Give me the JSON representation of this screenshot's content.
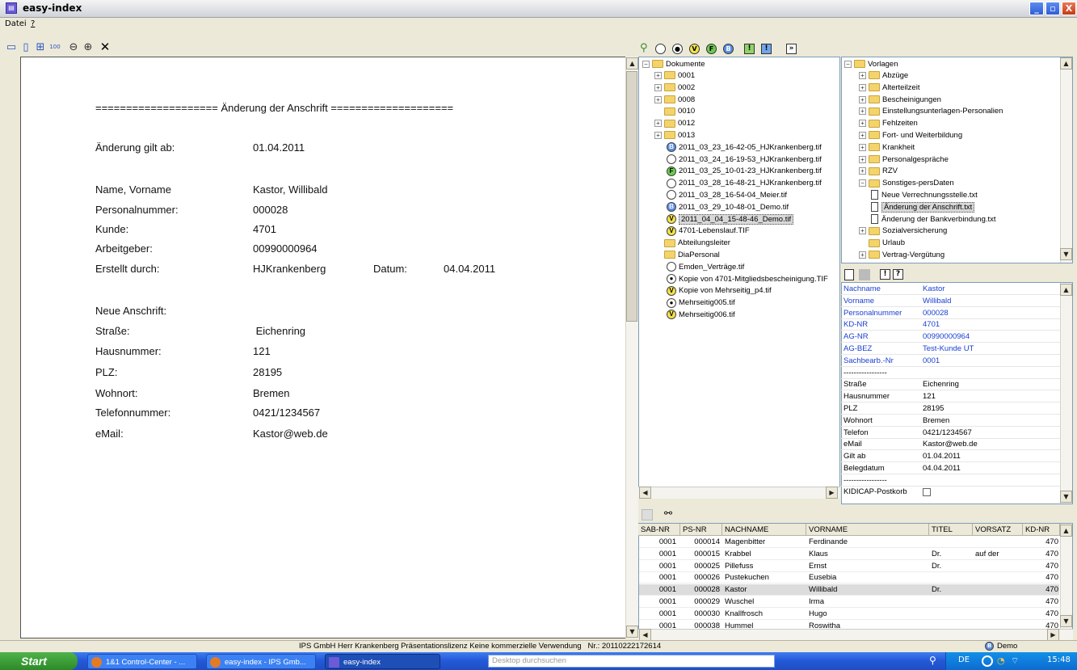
{
  "window": {
    "title": "easy-index",
    "min": "_",
    "max": "▫",
    "close": "X"
  },
  "menu": {
    "items": [
      "Datei",
      "?"
    ]
  },
  "toolbar_icons": [
    "rows-icon",
    "columns-icon",
    "grid-icon",
    "fit-icon",
    "zoom-out-icon",
    "zoom-in-icon",
    "close-icon"
  ],
  "document": {
    "heading": "==================== Änderung der Anschrift ====================",
    "change_label": "Änderung gilt ab:",
    "change_value": "01.04.2011",
    "rows": [
      {
        "label": "Name, Vorname",
        "value": "Kastor, Willibald"
      },
      {
        "label": "Personalnummer:",
        "value": "000028"
      },
      {
        "label": "Kunde:",
        "value": "4701"
      },
      {
        "label": "Arbeitgeber:",
        "value": "00990000964"
      },
      {
        "label": "Erstellt durch:",
        "value": "HJKrankenberg"
      }
    ],
    "datum_label": "Datum:",
    "datum_value": "04.04.2011",
    "new_address": "Neue Anschrift:",
    "addr": [
      {
        "label": "Straße:",
        "value": " Eichenring"
      },
      {
        "label": "Hausnummer:",
        "value": "121"
      },
      {
        "label": "PLZ:",
        "value": "28195"
      },
      {
        "label": "Wohnort:",
        "value": "Bremen"
      },
      {
        "label": "Telefonnummer:",
        "value": "0421/1234567"
      },
      {
        "label": "eMail:",
        "value": "Kastor@web.de"
      }
    ]
  },
  "filter_bar": {
    "marks": [
      "V",
      "F",
      "B"
    ],
    "warn": "!",
    "next": "»"
  },
  "tree_left": {
    "root": "Dokumente",
    "items": [
      {
        "type": "folder",
        "label": "0001",
        "exp": "+"
      },
      {
        "type": "folder",
        "label": "0002",
        "exp": "+"
      },
      {
        "type": "folder",
        "label": "0008",
        "exp": "+"
      },
      {
        "type": "folder",
        "label": "0010",
        "exp": ""
      },
      {
        "type": "folder",
        "label": "0012",
        "exp": "+"
      },
      {
        "type": "folder",
        "label": "0013",
        "exp": "+"
      },
      {
        "type": "file",
        "mark": "B",
        "label": "2011_03_23_16-42-05_HJKrankenberg.tif"
      },
      {
        "type": "file",
        "mark": "",
        "label": "2011_03_24_16-19-53_HJKrankenberg.tif"
      },
      {
        "type": "file",
        "mark": "F",
        "label": "2011_03_25_10-01-23_HJKrankenberg.tif"
      },
      {
        "type": "file",
        "mark": "",
        "label": "2011_03_28_16-48-21_HJKrankenberg.tif"
      },
      {
        "type": "file",
        "mark": "",
        "label": "2011_03_28_16-54-04_Meier.tif"
      },
      {
        "type": "file",
        "mark": "B",
        "label": "2011_03_29_10-48-01_Demo.tif"
      },
      {
        "type": "file",
        "mark": "V",
        "label": "2011_04_04_15-48-46_Demo.tif",
        "selected": true
      },
      {
        "type": "file",
        "mark": "V",
        "label": "4701-Lebenslauf.TIF"
      },
      {
        "type": "folder",
        "label": "Abteilungsleiter",
        "exp": ""
      },
      {
        "type": "folder",
        "label": "DiaPersonal",
        "exp": ""
      },
      {
        "type": "file",
        "mark": "",
        "label": "Emden_Verträge.tif"
      },
      {
        "type": "file",
        "mark": "dot",
        "label": "Kopie von 4701-Mitgliedsbescheinigung.TIF"
      },
      {
        "type": "file",
        "mark": "V",
        "label": "Kopie von Mehrseitig_p4.tif"
      },
      {
        "type": "file",
        "mark": "dot",
        "label": "Mehrseitig005.tif"
      },
      {
        "type": "file",
        "mark": "V",
        "label": "Mehrseitig006.tif"
      }
    ]
  },
  "tree_right": {
    "root": "Vorlagen",
    "items": [
      {
        "label": "Abzüge",
        "lvl": 1,
        "kind": "folder"
      },
      {
        "label": "Alterteilzeit",
        "lvl": 1,
        "kind": "folder"
      },
      {
        "label": "Bescheinigungen",
        "lvl": 1,
        "kind": "folder"
      },
      {
        "label": "Einstellungsunterlagen-Personalien",
        "lvl": 1,
        "kind": "folder"
      },
      {
        "label": "Fehlzeiten",
        "lvl": 1,
        "kind": "folder"
      },
      {
        "label": "Fort- und Weiterbildung",
        "lvl": 1,
        "kind": "folder"
      },
      {
        "label": "Krankheit",
        "lvl": 1,
        "kind": "folder"
      },
      {
        "label": "Personalgespräche",
        "lvl": 1,
        "kind": "folder"
      },
      {
        "label": "RZV",
        "lvl": 1,
        "kind": "folder"
      },
      {
        "label": "Sonstiges-persDaten",
        "lvl": 1,
        "kind": "open"
      },
      {
        "label": "Neue Verrechnungsstelle.txt",
        "lvl": 2,
        "kind": "file"
      },
      {
        "label": "Änderung der Anschrift.txt",
        "lvl": 2,
        "kind": "file",
        "selected": true
      },
      {
        "label": "Änderung der Bankverbindung.txt",
        "lvl": 2,
        "kind": "file"
      },
      {
        "label": "Sozialversicherung",
        "lvl": 1,
        "kind": "folder"
      },
      {
        "label": "Urlaub",
        "lvl": 1,
        "kind": "folder-noexp"
      },
      {
        "label": "Vertrag-Vergütung",
        "lvl": 1,
        "kind": "folder"
      }
    ]
  },
  "props_bar": {
    "warn": "!",
    "help": "?"
  },
  "props": [
    {
      "k": "Nachname",
      "v": "Kastor",
      "blue": true
    },
    {
      "k": "Vorname",
      "v": "Willibald",
      "blue": true
    },
    {
      "k": "Personalnummer",
      "v": "000028",
      "blue": true
    },
    {
      "k": "KD-NR",
      "v": "4701",
      "blue": true
    },
    {
      "k": "AG-NR",
      "v": "00990000964",
      "blue": true
    },
    {
      "k": "AG-BEZ",
      "v": "Test-Kunde UT",
      "blue": true
    },
    {
      "k": "Sachbearb.-Nr",
      "v": "0001",
      "blue": true
    },
    {
      "k": "-----------------",
      "v": ""
    },
    {
      "k": "Straße",
      "v": "Eichenring"
    },
    {
      "k": "Hausnummer",
      "v": "121"
    },
    {
      "k": "PLZ",
      "v": "28195"
    },
    {
      "k": "Wohnort",
      "v": "Bremen"
    },
    {
      "k": "Telefon",
      "v": "0421/1234567"
    },
    {
      "k": "eMail",
      "v": "Kastor@web.de"
    },
    {
      "k": "Gilt ab",
      "v": "01.04.2011"
    },
    {
      "k": "Belegdatum",
      "v": "04.04.2011"
    },
    {
      "k": "-----------------",
      "v": ""
    }
  ],
  "postkorb": {
    "label": "KIDICAP-Postkorb"
  },
  "grid": {
    "headers": [
      "SAB-NR",
      "PS-NR",
      "NACHNAME",
      "VORNAME",
      "TITEL",
      "VORSATZ",
      "KD-NR"
    ],
    "rows": [
      [
        "0001",
        "000014",
        "Magenbitter",
        "Ferdinande",
        "",
        "",
        "470"
      ],
      [
        "0001",
        "000015",
        "Krabbel",
        "Klaus",
        "Dr.",
        "auf der",
        "470"
      ],
      [
        "0001",
        "000025",
        "Pillefuss",
        "Ernst",
        "Dr.",
        "",
        "470"
      ],
      [
        "0001",
        "000026",
        "Pustekuchen",
        "Eusebia",
        "",
        "",
        "470"
      ],
      [
        "0001",
        "000028",
        "Kastor",
        "Willibald",
        "Dr.",
        "",
        "470"
      ],
      [
        "0001",
        "000029",
        "Wuschel",
        "Irma",
        "",
        "",
        "470"
      ],
      [
        "0001",
        "000030",
        "Knallfrosch",
        "Hugo",
        "",
        "",
        "470"
      ],
      [
        "0001",
        "000038",
        "Hummel",
        "Roswitha",
        "",
        "",
        "470"
      ]
    ]
  },
  "status": {
    "text": "IPS GmbH Herr Krankenberg Präsentationslizenz Keine kommerzielle Verwendung   Nr.: 20110222172614",
    "demo": "Demo"
  },
  "taskbar": {
    "start": "Start",
    "tasks": [
      "1&1 Control-Center - ...",
      "easy-index - IPS Gmb...",
      "easy-index"
    ],
    "search_placeholder": "Desktop durchsuchen",
    "lang": "DE",
    "clock": "15:48"
  }
}
